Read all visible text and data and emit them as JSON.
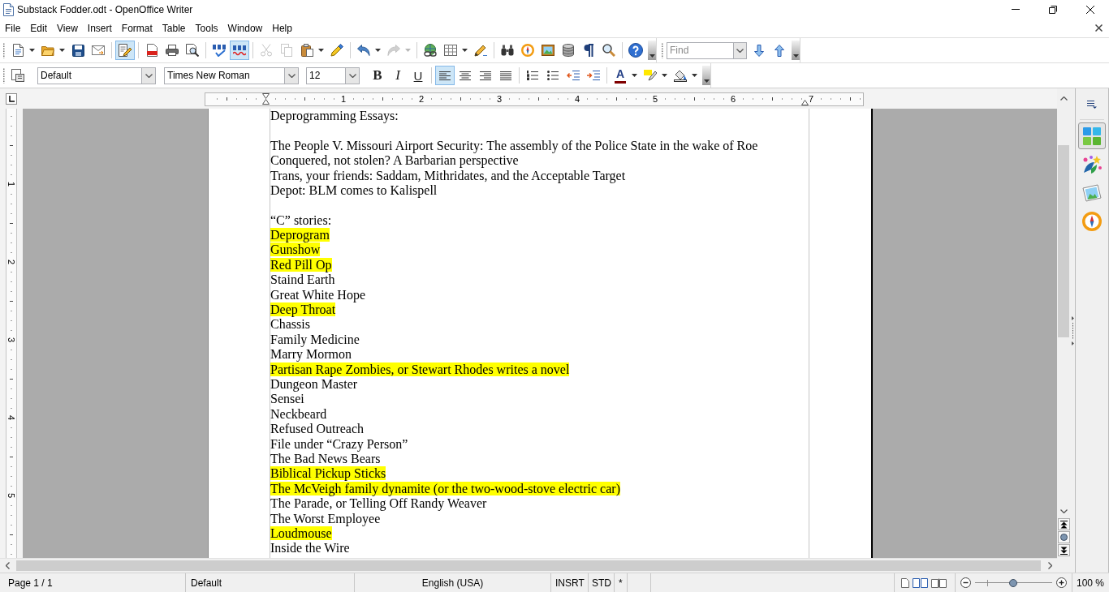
{
  "window": {
    "title": "Substack Fodder.odt - OpenOffice Writer"
  },
  "menu_bar": {
    "items": [
      {
        "label": "File"
      },
      {
        "label": "Edit"
      },
      {
        "label": "View"
      },
      {
        "label": "Insert"
      },
      {
        "label": "Format"
      },
      {
        "label": "Table"
      },
      {
        "label": "Tools"
      },
      {
        "label": "Window"
      },
      {
        "label": "Help"
      }
    ]
  },
  "standard_toolbar": {
    "items": [
      {
        "kind": "new",
        "dropdown": true,
        "selected": false,
        "disabled": false
      },
      {
        "kind": "open",
        "dropdown": true,
        "selected": false,
        "disabled": false
      },
      {
        "kind": "save",
        "dropdown": false,
        "selected": false,
        "disabled": false
      },
      {
        "kind": "email",
        "dropdown": false,
        "selected": false,
        "disabled": false
      },
      {
        "kind": "separator"
      },
      {
        "kind": "edit",
        "dropdown": false,
        "selected": true,
        "disabled": false
      },
      {
        "kind": "separator"
      },
      {
        "kind": "pdf",
        "dropdown": false,
        "selected": false,
        "disabled": false
      },
      {
        "kind": "print",
        "dropdown": false,
        "selected": false,
        "disabled": false
      },
      {
        "kind": "preview",
        "dropdown": false,
        "selected": false,
        "disabled": false
      },
      {
        "kind": "separator"
      },
      {
        "kind": "spelling",
        "dropdown": false,
        "selected": false,
        "disabled": false
      },
      {
        "kind": "autospell",
        "dropdown": false,
        "selected": true,
        "disabled": false
      },
      {
        "kind": "separator"
      },
      {
        "kind": "cut",
        "dropdown": false,
        "selected": false,
        "disabled": true
      },
      {
        "kind": "copy",
        "dropdown": false,
        "selected": false,
        "disabled": true
      },
      {
        "kind": "paste",
        "dropdown": true,
        "selected": false,
        "disabled": false
      },
      {
        "kind": "clone",
        "dropdown": false,
        "selected": false,
        "disabled": false
      },
      {
        "kind": "separator"
      },
      {
        "kind": "undo",
        "dropdown": true,
        "selected": false,
        "disabled": false
      },
      {
        "kind": "redo",
        "dropdown": true,
        "selected": false,
        "disabled": true
      },
      {
        "kind": "separator"
      },
      {
        "kind": "hyperlink",
        "dropdown": false,
        "selected": false,
        "disabled": false
      },
      {
        "kind": "table",
        "dropdown": true,
        "selected": false,
        "disabled": false
      },
      {
        "kind": "draw",
        "dropdown": false,
        "selected": false,
        "disabled": false
      },
      {
        "kind": "separator"
      },
      {
        "kind": "find",
        "dropdown": false,
        "selected": false,
        "disabled": false
      },
      {
        "kind": "navigator",
        "dropdown": false,
        "selected": false,
        "disabled": false
      },
      {
        "kind": "gallery",
        "dropdown": false,
        "selected": false,
        "disabled": false
      },
      {
        "kind": "datasource",
        "dropdown": false,
        "selected": false,
        "disabled": false
      },
      {
        "kind": "marks",
        "dropdown": false,
        "selected": false,
        "disabled": false
      },
      {
        "kind": "zoom",
        "dropdown": false,
        "selected": false,
        "disabled": false
      },
      {
        "kind": "separator"
      },
      {
        "kind": "help",
        "dropdown": false,
        "selected": false,
        "disabled": false
      }
    ]
  },
  "find_toolbar": {
    "placeholder": "Find"
  },
  "formatting_toolbar": {
    "paragraph_style": "Default",
    "font_name": "Times New Roman",
    "font_size": "12",
    "items": [
      {
        "kind": "bold",
        "glyph": "B",
        "dropdown": false,
        "selected": false
      },
      {
        "kind": "italic",
        "glyph": "I",
        "dropdown": false,
        "selected": false
      },
      {
        "kind": "underline",
        "glyph": "U",
        "dropdown": false,
        "selected": false
      },
      {
        "kind": "separator"
      },
      {
        "kind": "left",
        "dropdown": false,
        "selected": true
      },
      {
        "kind": "center",
        "dropdown": false,
        "selected": false
      },
      {
        "kind": "right",
        "dropdown": false,
        "selected": false
      },
      {
        "kind": "justify",
        "dropdown": false,
        "selected": false
      },
      {
        "kind": "separator"
      },
      {
        "kind": "numbering",
        "dropdown": false,
        "selected": false
      },
      {
        "kind": "bullets",
        "dropdown": false,
        "selected": false
      },
      {
        "kind": "outdent",
        "dropdown": false,
        "selected": false
      },
      {
        "kind": "indent",
        "dropdown": false,
        "selected": false
      },
      {
        "kind": "separator"
      },
      {
        "kind": "fontcolor",
        "glyph": "A",
        "dropdown": true,
        "selected": false
      },
      {
        "kind": "highlight",
        "dropdown": true,
        "selected": false
      },
      {
        "kind": "background",
        "dropdown": true,
        "selected": false
      }
    ]
  },
  "ruler": {
    "numbers": [
      "1",
      "2",
      "3",
      "4",
      "5",
      "6",
      "7"
    ]
  },
  "vertical_ruler": {
    "numbers": [
      "1",
      "2",
      "3",
      "4",
      "5"
    ]
  },
  "document": {
    "sections": [
      {
        "lines": [
          {
            "text": "Deprogramming Essays:",
            "highlighted": false
          }
        ]
      },
      {
        "lines": [
          {
            "text": "The People V. Missouri Airport Security: The assembly of the Police State in the wake of Roe",
            "highlighted": false
          },
          {
            "text": "Conquered, not stolen? A Barbarian perspective",
            "highlighted": false
          },
          {
            "text": "Trans, your friends: Saddam, Mithridates, and the Acceptable Target",
            "highlighted": false
          },
          {
            "text": "Depot: BLM comes to Kalispell",
            "highlighted": false
          }
        ]
      },
      {
        "lines": [
          {
            "text": "“C” stories:",
            "highlighted": false
          },
          {
            "text": "Deprogram",
            "highlighted": true
          },
          {
            "text": "Gunshow",
            "highlighted": true
          },
          {
            "text": "Red Pill Op",
            "highlighted": true
          },
          {
            "text": "Staind Earth",
            "highlighted": false
          },
          {
            "text": "Great White Hope",
            "highlighted": false
          },
          {
            "text": "Deep Throat",
            "highlighted": true
          },
          {
            "text": "Chassis",
            "highlighted": false
          },
          {
            "text": "Family Medicine",
            "highlighted": false
          },
          {
            "text": "Marry Mormon",
            "highlighted": false
          },
          {
            "text": "Partisan Rape Zombies, or Stewart Rhodes writes a novel",
            "highlighted": true
          },
          {
            "text": "Dungeon Master",
            "highlighted": false
          },
          {
            "text": "Sensei",
            "highlighted": false
          },
          {
            "text": "Neckbeard",
            "highlighted": false
          },
          {
            "text": "Refused Outreach",
            "highlighted": false
          },
          {
            "text": "File under “Crazy Person”",
            "highlighted": false
          },
          {
            "text": "The Bad News Bears",
            "highlighted": false
          },
          {
            "text": "Biblical Pickup Sticks",
            "highlighted": true
          },
          {
            "text": "The McVeigh family dynamite (or the two-wood-stove electric car)",
            "highlighted": true
          },
          {
            "text": "The Parade, or Telling Off Randy Weaver",
            "highlighted": false
          },
          {
            "text": "The Worst Employee",
            "highlighted": false
          },
          {
            "text": "Loudmouse",
            "highlighted": true
          },
          {
            "text": "Inside the Wire",
            "highlighted": false
          }
        ]
      }
    ]
  },
  "sidebar": {
    "items": [
      {
        "kind": "properties",
        "selected": true
      },
      {
        "kind": "styles",
        "selected": false
      },
      {
        "kind": "gallery",
        "selected": false
      },
      {
        "kind": "navigator",
        "selected": false
      }
    ]
  },
  "status_bar": {
    "page": "Page 1 / 1",
    "page_style": "Default",
    "language": "English (USA)",
    "insert_mode": "INSRT",
    "selection_mode": "STD",
    "modified": "*",
    "zoom": {
      "level": 0.49,
      "reading": "100 %"
    }
  }
}
